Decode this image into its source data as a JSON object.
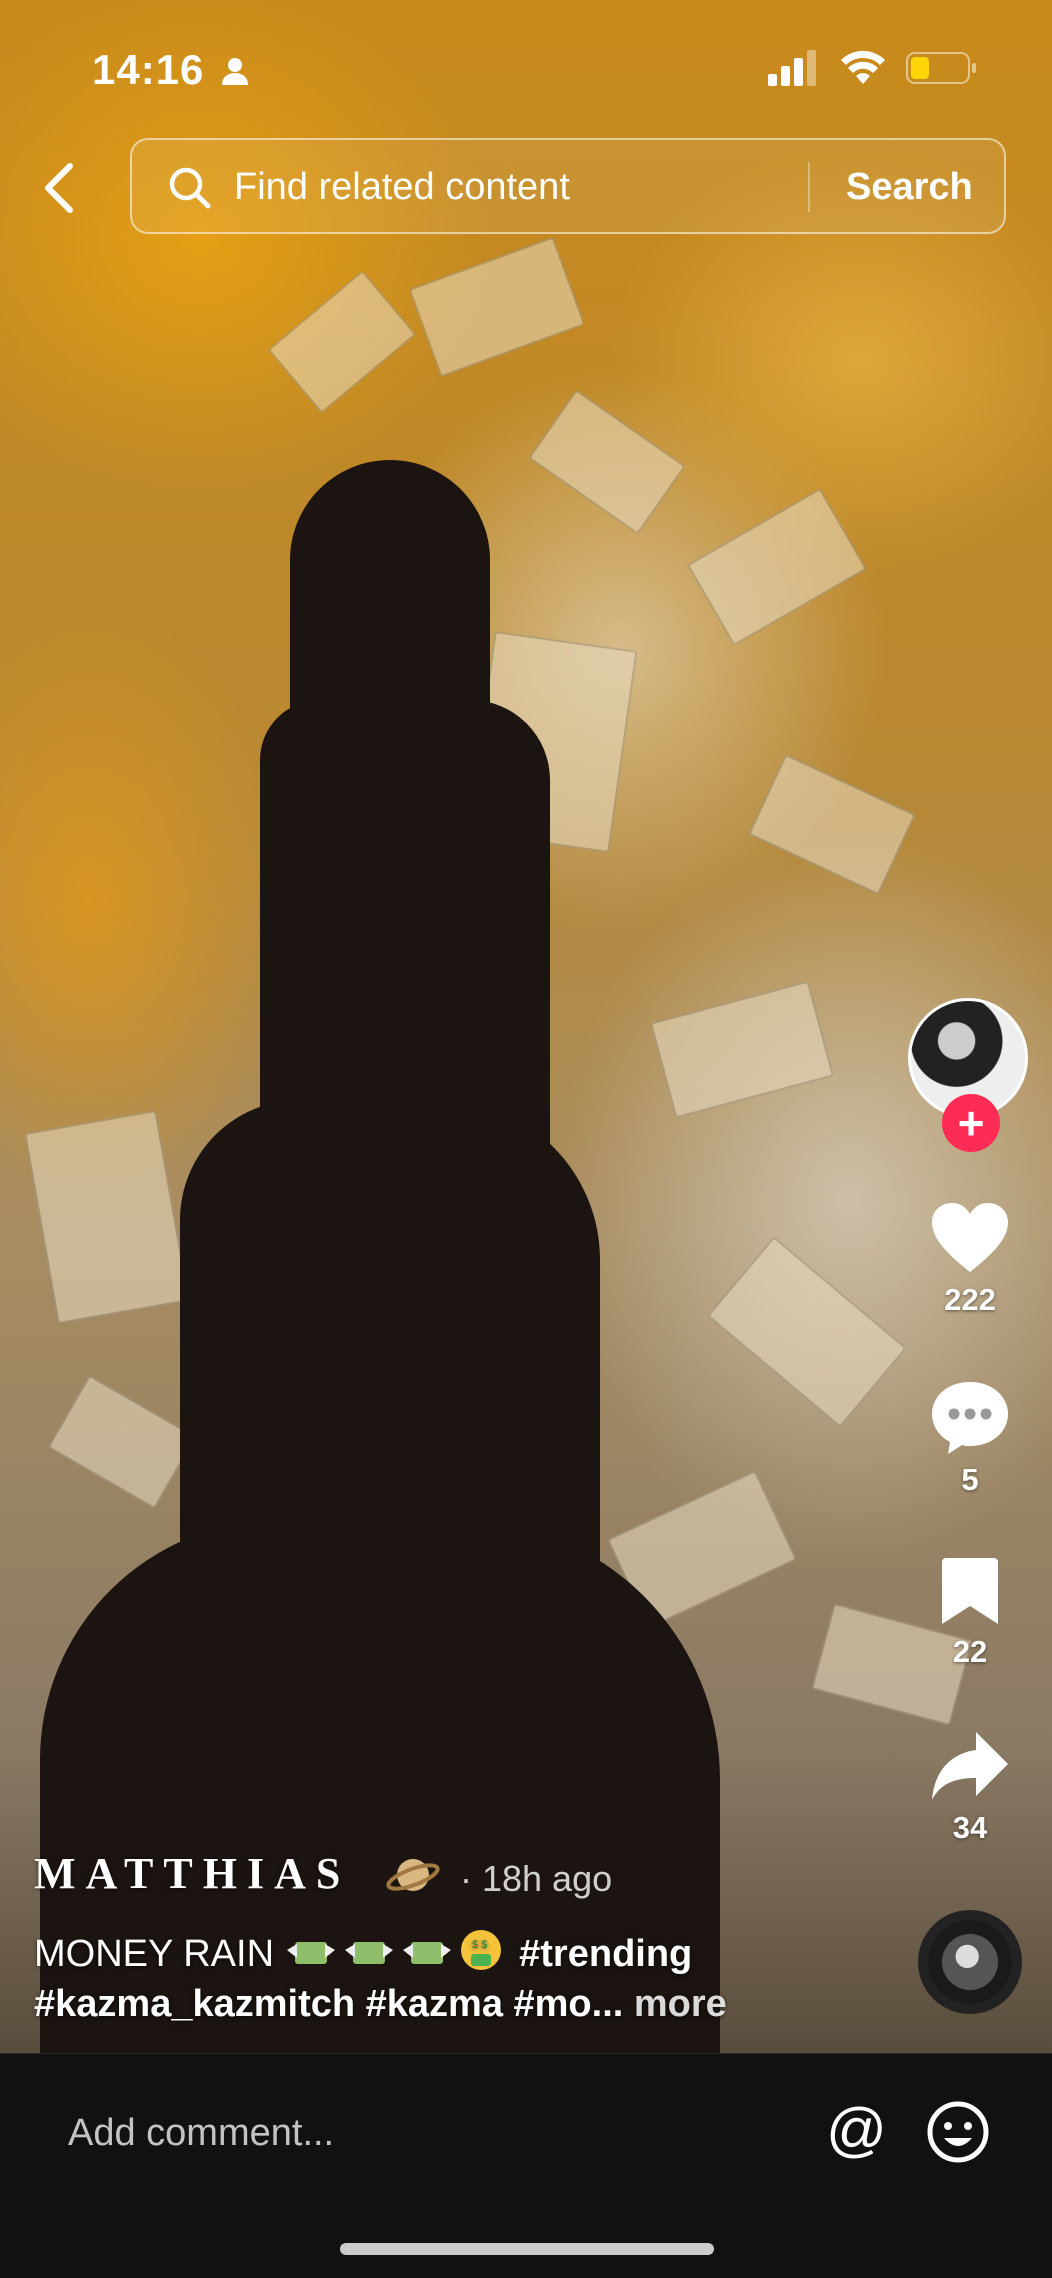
{
  "status_bar": {
    "time": "14:16"
  },
  "search": {
    "placeholder": "Find related content",
    "button_label": "Search"
  },
  "actions": {
    "likes": "222",
    "comments": "5",
    "bookmarks": "22",
    "shares": "34"
  },
  "post": {
    "author": "MATTHIAS",
    "time_ago": "· 18h ago",
    "caption_line1": "MONEY RAIN",
    "caption_tag": "#trending",
    "caption_line2": "#kazma_kazmitch #kazma #mo...",
    "more_label": "more"
  },
  "comment_bar": {
    "placeholder": "Add comment..."
  },
  "colors": {
    "follow": "#fe2c55",
    "battery": "#ffd60a",
    "comment_bar_bg": "#111111"
  },
  "icons": [
    "back-icon",
    "search-icon",
    "heart-icon",
    "comment-icon",
    "bookmark-icon",
    "share-icon",
    "at-icon",
    "emoji-icon",
    "person-icon",
    "signal-icon",
    "wifi-icon",
    "battery-icon",
    "planet-icon"
  ]
}
